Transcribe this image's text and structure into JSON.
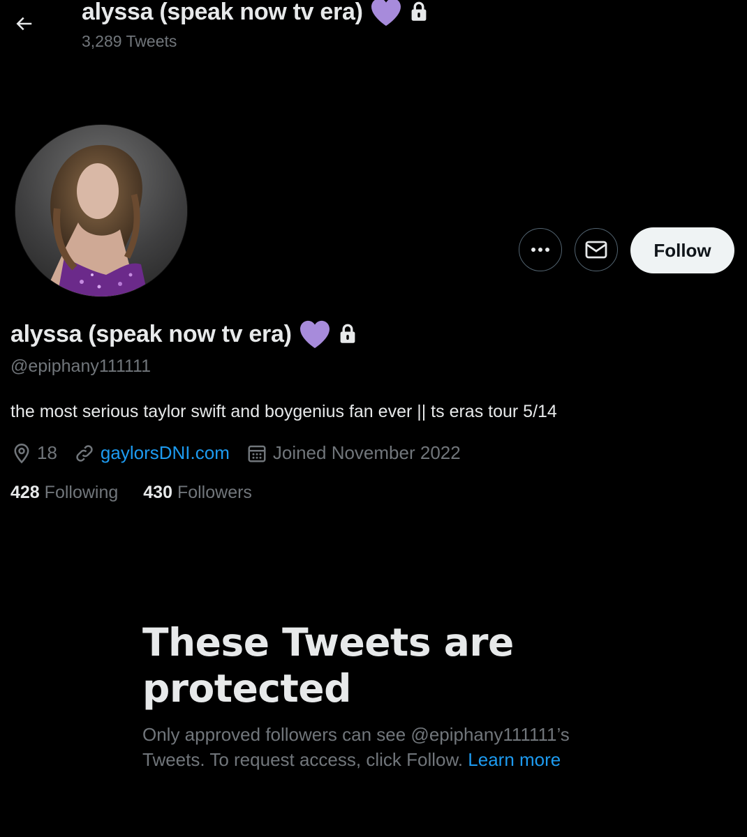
{
  "header": {
    "title": "alyssa (speak now tv era)",
    "tweet_count": "3,289 Tweets",
    "heart_emoji": "💜",
    "back_icon": "arrow-left-icon"
  },
  "profile": {
    "display_name": "alyssa (speak now tv era)",
    "handle": "@epiphany111111",
    "bio": "the most serious taylor swift and boygenius fan ever || ts eras tour 5/14",
    "location": "18",
    "website": "gaylorsDNI.com",
    "joined": "Joined November 2022",
    "following_count": "428",
    "following_label": "Following",
    "followers_count": "430",
    "followers_label": "Followers",
    "heart_emoji": "💜"
  },
  "actions": {
    "follow_label": "Follow",
    "more_icon": "more-icon",
    "message_icon": "envelope-icon"
  },
  "protected": {
    "title": "These Tweets are protected",
    "description": "Only approved followers can see @epiphany111111’s Tweets. To request access, click Follow.",
    "learn_more": "Learn more"
  },
  "colors": {
    "background": "#000000",
    "text_primary": "#e7e9ea",
    "text_secondary": "#71767b",
    "link": "#1d9bf0",
    "heart": "#a78bdb",
    "follow_bg": "#eff3f4"
  }
}
